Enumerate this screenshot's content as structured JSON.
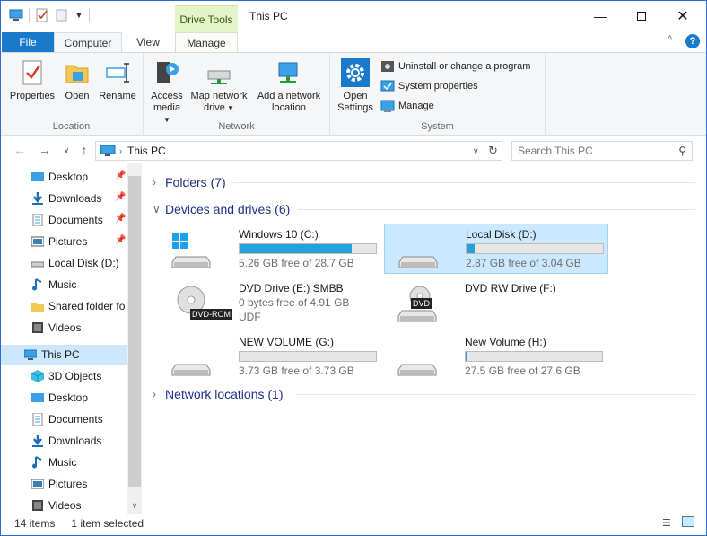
{
  "window": {
    "title": "This PC",
    "context_tab": "Drive Tools"
  },
  "ribbon_tabs": {
    "file": "File",
    "computer": "Computer",
    "view": "View",
    "manage": "Manage"
  },
  "ribbon": {
    "location": {
      "label": "Location",
      "properties": "Properties",
      "open": "Open",
      "rename": "Rename"
    },
    "network": {
      "label": "Network",
      "access_media_1": "Access",
      "access_media_2": "media",
      "map_drive_1": "Map network",
      "map_drive_2": "drive",
      "add_location_1": "Add a network",
      "add_location_2": "location"
    },
    "system": {
      "label": "System",
      "open_settings_1": "Open",
      "open_settings_2": "Settings",
      "uninstall": "Uninstall or change a program",
      "system_properties": "System properties",
      "manage": "Manage"
    }
  },
  "address": {
    "path": "This PC",
    "search_placeholder": "Search This PC"
  },
  "sidebar": {
    "quick_access": [
      {
        "label": "Desktop",
        "icon": "desktop-icon",
        "pinned": true
      },
      {
        "label": "Downloads",
        "icon": "downloads-icon",
        "pinned": true
      },
      {
        "label": "Documents",
        "icon": "documents-icon",
        "pinned": true
      },
      {
        "label": "Pictures",
        "icon": "pictures-icon",
        "pinned": true
      },
      {
        "label": "Local Disk (D:)",
        "icon": "drive-icon",
        "pinned": false
      },
      {
        "label": "Music",
        "icon": "music-icon",
        "pinned": false
      },
      {
        "label": "Shared folder fo",
        "icon": "folder-icon",
        "pinned": false
      },
      {
        "label": "Videos",
        "icon": "videos-icon",
        "pinned": false
      }
    ],
    "this_pc": "This PC",
    "this_pc_children": [
      {
        "label": "3D Objects",
        "icon": "3d-objects-icon"
      },
      {
        "label": "Desktop",
        "icon": "desktop-icon"
      },
      {
        "label": "Documents",
        "icon": "documents-icon"
      },
      {
        "label": "Downloads",
        "icon": "downloads-icon"
      },
      {
        "label": "Music",
        "icon": "music-icon"
      },
      {
        "label": "Pictures",
        "icon": "pictures-icon"
      },
      {
        "label": "Videos",
        "icon": "videos-icon"
      }
    ]
  },
  "main": {
    "folders_header": "Folders (7)",
    "devices_header": "Devices and drives (6)",
    "network_header": "Network locations (1)",
    "drives": [
      {
        "name": "Windows 10 (C:)",
        "free": "5.26 GB free of 28.7 GB",
        "used_fraction": 0.82
      },
      {
        "name": "Local Disk (D:)",
        "free": "2.87 GB free of 3.04 GB",
        "used_fraction": 0.06
      },
      {
        "name": "DVD Drive (E:) SMBB",
        "free": "0 bytes free of 4.91 GB",
        "fs": "UDF",
        "badge": "DVD-ROM"
      },
      {
        "name": "DVD RW Drive (F:)",
        "badge": "DVD"
      },
      {
        "name": "NEW VOLUME (G:)",
        "free": "3.73 GB free of 3.73 GB",
        "used_fraction": 0.0
      },
      {
        "name": "New Volume (H:)",
        "free": "27.5 GB free of 27.6 GB",
        "used_fraction": 0.004
      }
    ]
  },
  "status": {
    "items": "14 items",
    "selected": "1 item selected"
  },
  "colors": {
    "accent": "#1979ca",
    "selection": "#cce8ff",
    "bar_fill": "#26a0da",
    "context_tab": "#e4f3c9",
    "header_text": "#1e3287"
  }
}
